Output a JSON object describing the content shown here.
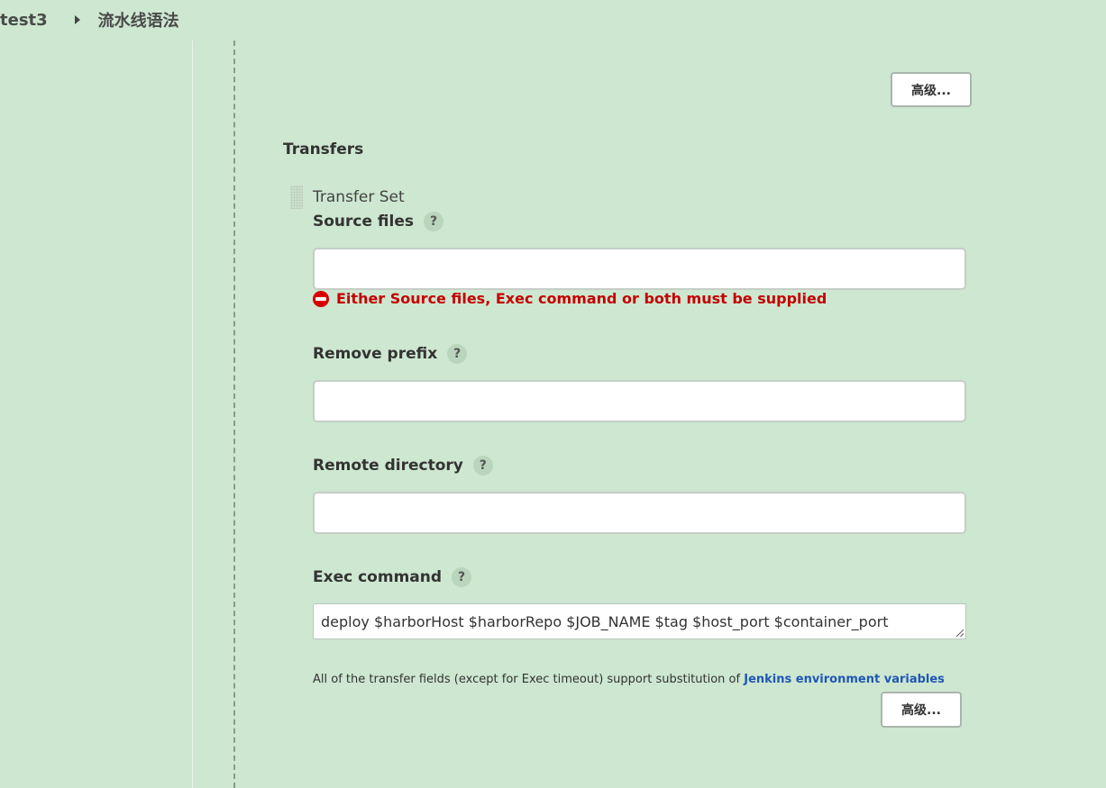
{
  "breadcrumb": {
    "item1": "test3",
    "item2": "流水线语法"
  },
  "buttons": {
    "advanced_top": "高级...",
    "advanced_bottom": "高级..."
  },
  "transfers": {
    "title": "Transfers",
    "set_title": "Transfer Set",
    "source_files": {
      "label": "Source files",
      "value": "",
      "help": "?"
    },
    "error": "Either Source files, Exec command or both must be supplied",
    "remove_prefix": {
      "label": "Remove prefix",
      "value": "",
      "help": "?"
    },
    "remote_directory": {
      "label": "Remote directory",
      "value": "",
      "help": "?"
    },
    "exec_command": {
      "label": "Exec command",
      "value": "deploy $harborHost $harborRepo $JOB_NAME $tag $host_port $container_port",
      "help": "?"
    },
    "note": "All of the transfer fields (except for Exec timeout) support substitution of",
    "note_link": "Jenkins environment variables"
  }
}
